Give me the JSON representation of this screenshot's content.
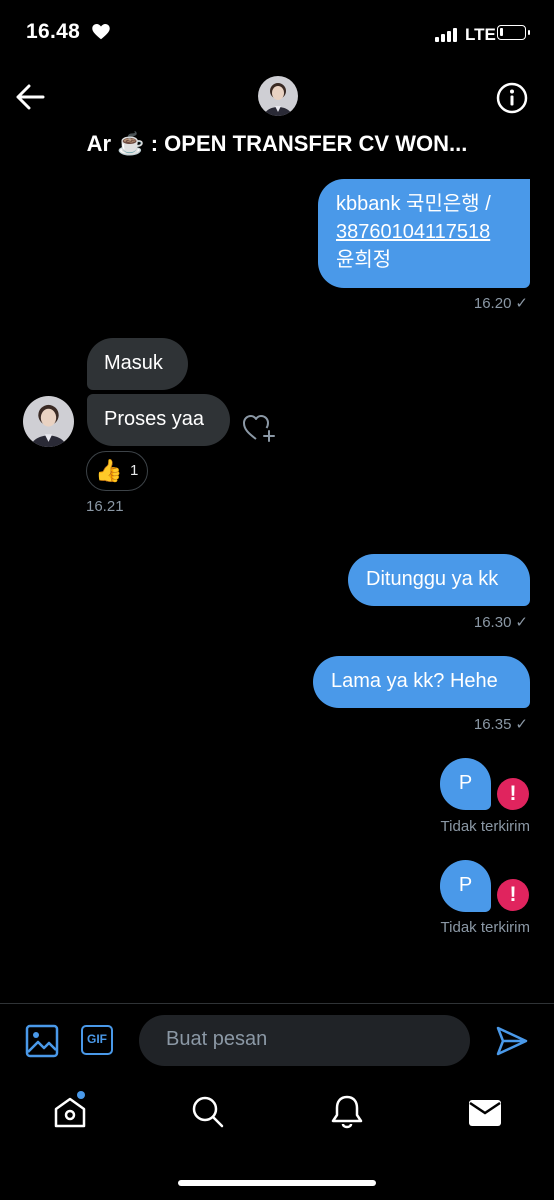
{
  "status_bar": {
    "time": "16.48",
    "network": "LTE",
    "battery_level": 0.15
  },
  "header": {
    "title": "Ar ☕️ : OPEN TRANSFER CV WON...",
    "icons": [
      "back-arrow-icon",
      "avatar",
      "info-icon"
    ]
  },
  "messages": [
    {
      "direction": "outgoing",
      "lines": [
        "kbbank 국민은행 /",
        "38760104117518",
        "윤희정"
      ],
      "time": "16.20",
      "status": "✓"
    },
    {
      "direction": "incoming",
      "text": "Masuk"
    },
    {
      "direction": "incoming",
      "text": "Proses yaa",
      "reaction": {
        "emoji": "👍",
        "count": "1"
      },
      "time": "16.21"
    },
    {
      "direction": "outgoing",
      "text": "Ditunggu ya kk",
      "time": "16.30",
      "status": "✓"
    },
    {
      "direction": "outgoing",
      "text": "Lama ya kk? Hehe",
      "time": "16.35",
      "status": "✓"
    },
    {
      "direction": "outgoing",
      "text": "P",
      "error_icon": "!",
      "status_text": "Tidak terkirim"
    },
    {
      "direction": "outgoing",
      "text": "P",
      "error_icon": "!",
      "status_text": "Tidak terkirim"
    }
  ],
  "composer": {
    "placeholder": "Buat pesan",
    "gif_label": "GIF"
  },
  "bottom_nav": [
    "home-icon",
    "search-icon",
    "notifications-icon",
    "messages-icon"
  ],
  "colors": {
    "accent": "#4a99e9",
    "incoming_bubble": "#2f3336",
    "error": "#e0245e",
    "timestamp": "#8b98a5"
  }
}
